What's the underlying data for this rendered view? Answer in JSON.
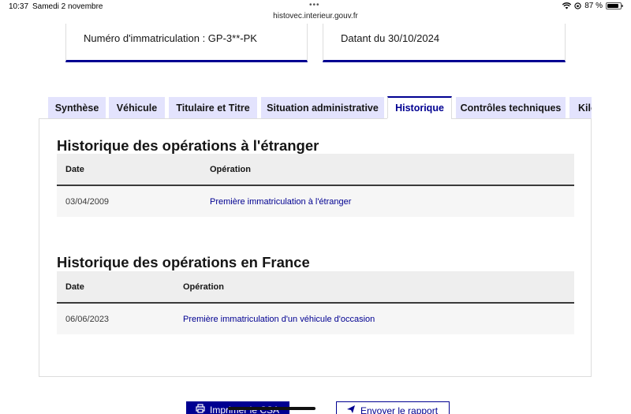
{
  "status_bar": {
    "time": "10:37",
    "date": "Samedi 2 novembre",
    "battery": "87 %"
  },
  "browser": {
    "url": "histovec.interieur.gouv.fr"
  },
  "cards": {
    "registration": "Numéro d'immatriculation : GP-3**-PK",
    "date": "Datant du 30/10/2024"
  },
  "tabs": [
    {
      "label": "Synthèse"
    },
    {
      "label": "Véhicule"
    },
    {
      "label": "Titulaire et Titre"
    },
    {
      "label": "Situation administrative"
    },
    {
      "label": "Historique",
      "active": true
    },
    {
      "label": "Contrôles techniques"
    },
    {
      "label": "Kilo"
    }
  ],
  "foreign_history": {
    "title": "Historique des opérations à l'étranger",
    "headers": [
      "Date",
      "Opération"
    ],
    "rows": [
      {
        "date": "03/04/2009",
        "operation": "Première immatriculation à l'étranger"
      }
    ]
  },
  "france_history": {
    "title": "Historique des opérations en France",
    "headers": [
      "Date",
      "Opération"
    ],
    "rows": [
      {
        "date": "06/06/2023",
        "operation": "Première immatriculation d'un véhicule d'occasion"
      }
    ]
  },
  "actions": {
    "print_label": "Imprimer le CSA",
    "send_label": "Envoyer le rapport"
  },
  "colors": {
    "primary": "#000091",
    "tab_background": "#e3e3fd",
    "table_header": "#eeeeee"
  }
}
